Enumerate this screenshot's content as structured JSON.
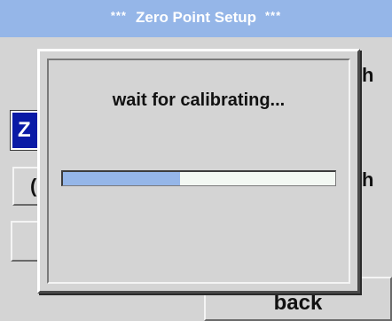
{
  "title": {
    "prefix": "***",
    "text": "Zero Point Setup",
    "suffix": "***"
  },
  "background": {
    "selected_button_glyph": "Z",
    "row1_glyph": "h",
    "row2_glyph": "h",
    "button2_glyph": "(",
    "back_label": "back"
  },
  "dialog": {
    "message": "wait for calibrating...",
    "progress": 0.43
  },
  "colors": {
    "title_bar": "#95b6e8",
    "progress_fill": "#95b6e8",
    "selected_button": "#0a1aa6",
    "panel": "#d4d4d4"
  }
}
